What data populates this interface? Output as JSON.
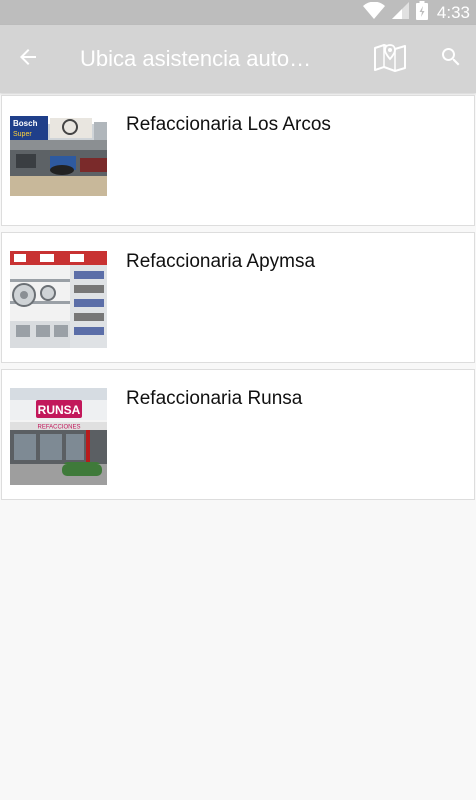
{
  "status_bar": {
    "time": "4:33",
    "icons": [
      "wifi-icon",
      "signal-icon",
      "battery-icon"
    ]
  },
  "app_bar": {
    "title": "Ubica asistencia auto…",
    "icons": [
      "back-arrow-icon",
      "map-icon",
      "search-icon"
    ]
  },
  "listings": [
    {
      "name": "Refaccionaria Los Arcos",
      "image_icon": "storefront-photo"
    },
    {
      "name": "Refaccionaria Apymsa",
      "image_icon": "store-interior-photo"
    },
    {
      "name": "Refaccionaria Runsa",
      "image_icon": "storefront-photo"
    }
  ],
  "thumb_texts": {
    "los_arcos_sign_1": "Bosch",
    "los_arcos_sign_2": "Super",
    "runsa_sign": "RUNSA",
    "runsa_banner": "REFACCIONES"
  },
  "colors": {
    "status_bar": "#bdbdbd",
    "app_bar": "#d4d4d4",
    "background": "#f8f8f8",
    "card": "#ffffff"
  }
}
